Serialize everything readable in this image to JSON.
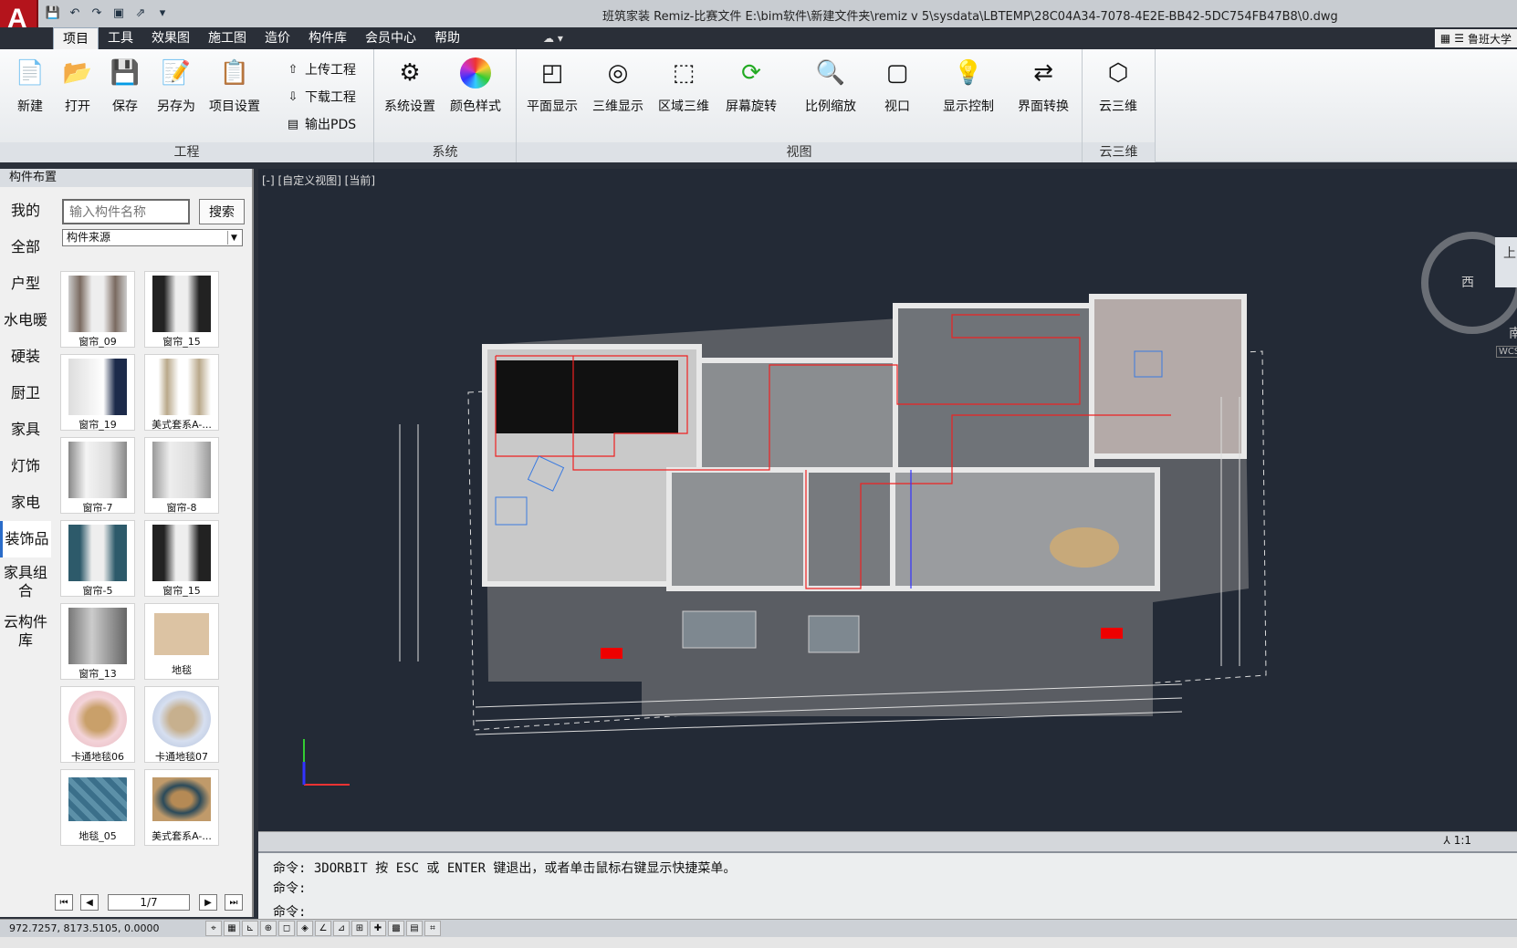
{
  "window": {
    "title": "班筑家装 Remiz-比赛文件     E:\\bim软件\\新建文件夹\\remiz v 5\\sysdata\\LBTEMP\\28C04A34-7078-4E2E-BB42-5DC754FB47B8\\0.dwg",
    "logo": "A"
  },
  "quick_access": [
    "save-icon",
    "undo-icon",
    "redo-icon",
    "print-icon",
    "share-icon",
    "dropdown-icon"
  ],
  "menu": {
    "tabs": [
      "项目",
      "工具",
      "效果图",
      "施工图",
      "造价",
      "构件库",
      "会员中心",
      "帮助"
    ],
    "active": 0,
    "extra": "☁ ▾",
    "right_label": "鲁班大学"
  },
  "ribbon": {
    "project": {
      "label": "工程",
      "buttons": [
        "新建",
        "打开",
        "保存",
        "另存为",
        "项目设置"
      ],
      "small": [
        "上传工程",
        "下载工程",
        "输出PDS"
      ]
    },
    "system": {
      "label": "系统",
      "buttons": [
        "系统设置",
        "颜色样式"
      ]
    },
    "view": {
      "label": "视图",
      "buttons": [
        "平面显示",
        "三维显示",
        "区域三维",
        "屏幕旋转",
        "比例缩放",
        "视口",
        "显示控制",
        "界面转换"
      ]
    },
    "cloud3d": {
      "label": "云三维",
      "buttons": [
        "云三维"
      ]
    }
  },
  "left_panel": {
    "title": "构件布置",
    "categories": [
      "我的",
      "全部",
      "户型",
      "水电暖",
      "硬装",
      "厨卫",
      "家具",
      "灯饰",
      "家电",
      "装饰品",
      "家具组合",
      "云构件库"
    ],
    "active_category": 9,
    "search_placeholder": "输入构件名称",
    "search_button": "搜索",
    "source_select": "构件来源",
    "items": [
      "窗帘_09",
      "窗帘_15",
      "窗帘_19",
      "美式套系A-...",
      "窗帘-7",
      "窗帘-8",
      "窗帘-5",
      "窗帘_15",
      "窗帘_13",
      "地毯",
      "卡通地毯06",
      "卡通地毯07",
      "地毯_05",
      "美式套系A-..."
    ],
    "page": "1/7"
  },
  "viewport": {
    "label": "[-] [自定义视图] [当前]",
    "compass_west": "西",
    "compass_south": "南",
    "compass_top": "上",
    "compass_wcs": "WCS",
    "scale": "1:1"
  },
  "command": {
    "line1": "命令: 3DORBIT 按 ESC 或 ENTER 键退出，或者单击鼠标右键显示快捷菜单。",
    "line2": "命令:",
    "prompt": "命令:"
  },
  "status": {
    "coords": "972.7257,   8173.5105,  0.0000"
  }
}
